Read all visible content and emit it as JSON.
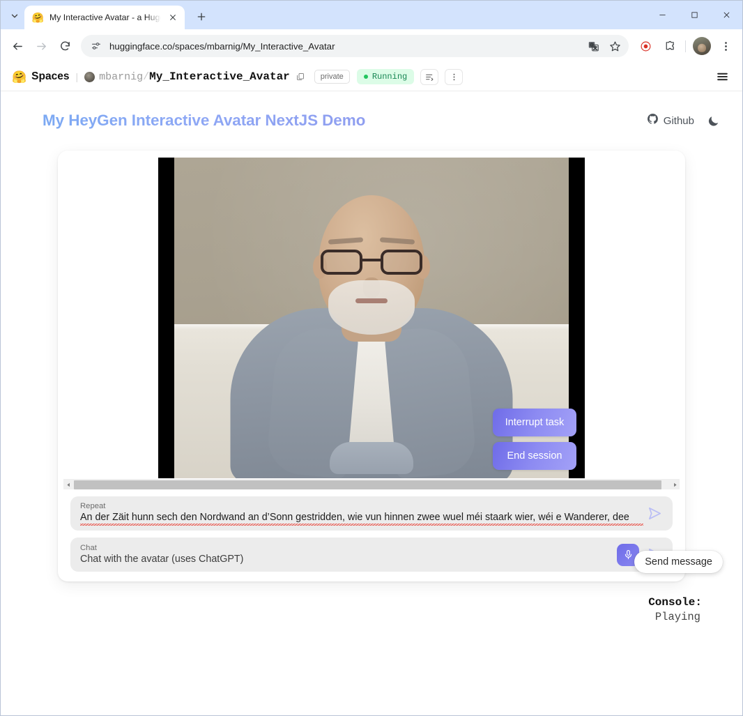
{
  "browser": {
    "tab": {
      "title": "My Interactive Avatar - a Hugg",
      "favicon": "🤗",
      "close_icon": "close-icon"
    },
    "newtab_label": "+",
    "url": "huggingface.co/spaces/mbarnig/My_Interactive_Avatar",
    "window_controls": {
      "minimize": "−",
      "maximize": "□",
      "close": "✕"
    },
    "toolbar_icons": {
      "back": "back-arrow-icon",
      "forward": "forward-arrow-icon",
      "reload": "reload-icon",
      "site_info": "site-settings-icon",
      "translate": "translate-icon",
      "bookmark": "star-icon",
      "record": "record-icon",
      "extensions": "extensions-puzzle-icon",
      "profile": "profile-avatar",
      "menu": "kebab-menu-icon"
    }
  },
  "hf_header": {
    "logo": "🤗",
    "spaces_label": "Spaces",
    "owner": "mbarnig",
    "separator": "/",
    "repo": "My_Interactive_Avatar",
    "visibility_badge": "private",
    "status": "Running",
    "status_color": "#22c55e"
  },
  "app": {
    "title": "My HeyGen Interactive Avatar NextJS Demo",
    "github_label": "Github",
    "theme_toggle": "moon-icon"
  },
  "video": {
    "interrupt_label": "Interrupt task",
    "end_label": "End session",
    "accent_color": "#7c7af0"
  },
  "repeat_field": {
    "label": "Repeat",
    "value": "An der Zäit hunn sech den Nordwand an d’Sonn gestridden, wie vun hinnen zwee wuel méi staark wier, wéi e Wanderer, dee"
  },
  "chat_field": {
    "label": "Chat",
    "placeholder": "Chat with the avatar (uses ChatGPT)"
  },
  "tooltip": {
    "text": "Send message"
  },
  "console": {
    "label": "Console:",
    "value": "Playing"
  }
}
